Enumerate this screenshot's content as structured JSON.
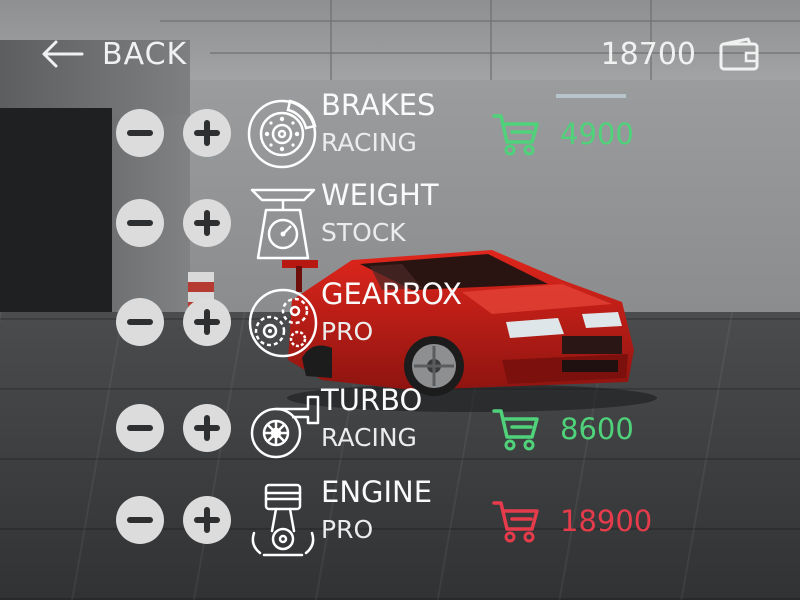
{
  "header": {
    "back_label": "BACK",
    "balance": "18700"
  },
  "parts": [
    {
      "name": "BRAKES",
      "level": "RACING",
      "icon": "brake-disc-icon",
      "price": "4900",
      "affordable": true
    },
    {
      "name": "WEIGHT",
      "level": "STOCK",
      "icon": "scale-icon",
      "price": "",
      "affordable": null
    },
    {
      "name": "GEARBOX",
      "level": "PRO",
      "icon": "gears-icon",
      "price": "",
      "affordable": null
    },
    {
      "name": "TURBO",
      "level": "RACING",
      "icon": "turbo-icon",
      "price": "8600",
      "affordable": true
    },
    {
      "name": "ENGINE",
      "level": "PRO",
      "icon": "piston-icon",
      "price": "18900",
      "affordable": false
    }
  ],
  "colors": {
    "affordable": "#4fd27a",
    "unaffordable": "#e53b4b",
    "car_body": "#c81c14"
  }
}
